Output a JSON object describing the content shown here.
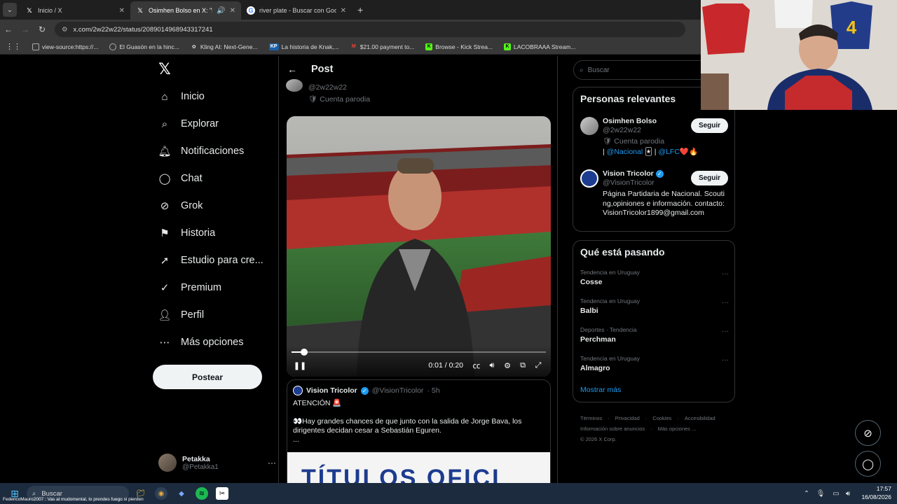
{
  "browser": {
    "tabs": [
      {
        "title": "Inicio / X",
        "active": false
      },
      {
        "title": "Osimhen Bolso en X: \"https:",
        "active": true
      },
      {
        "title": "river plate - Buscar con Google",
        "active": false
      }
    ],
    "url": "x.com/2w22w22/status/2089014968943317241",
    "bookmarks": [
      "view-source:https://...",
      "El Guasón en la hinc...",
      "Kling AI: Next-Gene...",
      "La historia de Knak,...",
      "$21.00 payment to...",
      "Browse - Kick Strea...",
      "LACOBRAAA Stream..."
    ]
  },
  "nav": {
    "items": [
      "Inicio",
      "Explorar",
      "Notificaciones",
      "Chat",
      "Grok",
      "Historia",
      "Estudio para cre...",
      "Premium",
      "Perfil",
      "Más opciones"
    ],
    "post_button": "Postear",
    "account": {
      "name": "Petakka",
      "handle": "@Petakka1"
    }
  },
  "post": {
    "header": "Post",
    "author_handle": "@2w22w22",
    "author_badge": "Cuenta parodia",
    "video": {
      "time": "0:01 / 0:20",
      "progress": 0.05
    }
  },
  "quote": {
    "name": "Vision Tricolor",
    "handle": "@VisionTricolor",
    "time": "· 5h",
    "line1": "ATENCIÓN 🚨",
    "line2": "👀Hay grandes chances de que junto con la salida de Jorge Bava, los dirigentes decidan cesar a Sebastián Eguren.",
    "line3": "...",
    "image_text": "TÍTULOS OFICI"
  },
  "search": {
    "placeholder": "Buscar"
  },
  "relevant": {
    "title": "Personas relevantes",
    "people": [
      {
        "name": "Osimhen Bolso",
        "handle": "@2w22w22",
        "bio1": "Cuenta parodia",
        "bio2a": "| ",
        "bio2b": "@Nacional",
        "bio2c": " 🃏 | ",
        "bio2d": "@LFC",
        "bio2e": "❤️🔥",
        "follow": "Seguir"
      },
      {
        "name": "Vision Tricolor",
        "handle": "@VisionTricolor",
        "bio": "Página Partidaria de Nacional. Scouting,opiniones e información. contacto:VisionTricolor1899@gmail.com",
        "follow": "Seguir"
      }
    ]
  },
  "trending": {
    "title": "Qué está pasando",
    "items": [
      {
        "context": "Tendencia en Uruguay",
        "name": "Cosse"
      },
      {
        "context": "Tendencia en Uruguay",
        "name": "Balbi"
      },
      {
        "context": "Deportes · Tendencia",
        "name": "Perchman"
      },
      {
        "context": "Tendencia en Uruguay",
        "name": "Almagro"
      }
    ],
    "more": "Mostrar más"
  },
  "footer": [
    "Términos",
    "Privacidad",
    "Cookies",
    "Accesibilidad",
    "Información sobre anuncios",
    "Más opciones ...",
    "© 2026 X Corp."
  ],
  "taskbar": {
    "search": "Buscar",
    "time": "17:57",
    "date": "16/08/2026",
    "marquee": "FedericoMauro2007 : Vas al mudomental, lo prendes fuego si pierden"
  }
}
